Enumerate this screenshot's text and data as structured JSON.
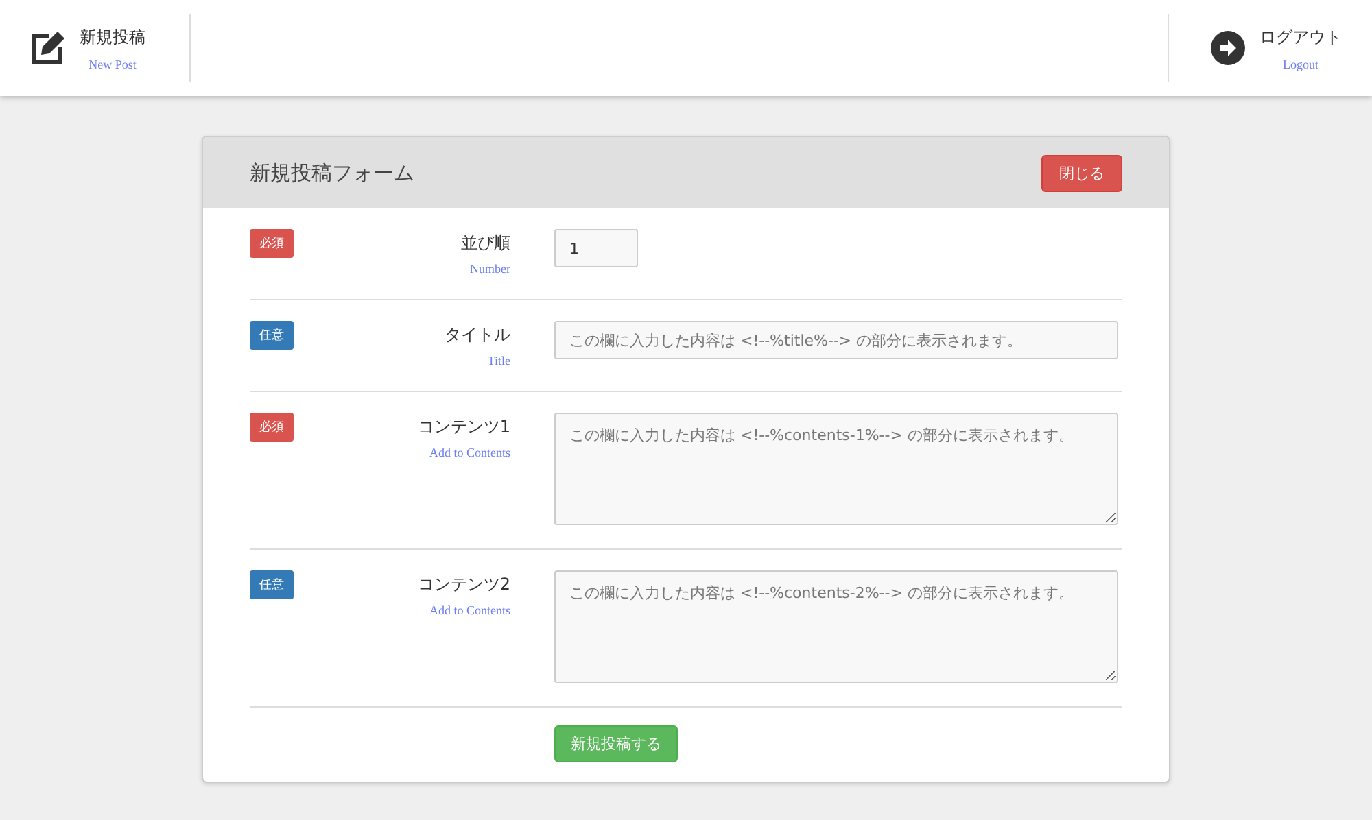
{
  "header": {
    "left": {
      "label": "新規投稿",
      "sublabel": "New Post"
    },
    "right": {
      "label": "ログアウト",
      "sublabel": "Logout"
    }
  },
  "form": {
    "title": "新規投稿フォーム",
    "close_button": "閉じる",
    "fields": [
      {
        "kind": "number",
        "badge": "必須",
        "required": true,
        "label": "並び順",
        "sublabel": "Number",
        "value": "1"
      },
      {
        "kind": "text",
        "badge": "任意",
        "required": false,
        "label": "タイトル",
        "sublabel": "Title",
        "placeholder": "この欄に入力した内容は <!--%title%--> の部分に表示されます。"
      },
      {
        "kind": "textarea",
        "badge": "必須",
        "required": true,
        "label": "コンテンツ1",
        "sublabel": "Add to Contents",
        "placeholder": "この欄に入力した内容は <!--%contents-1%--> の部分に表示されます。"
      },
      {
        "kind": "textarea",
        "badge": "任意",
        "required": false,
        "label": "コンテンツ2",
        "sublabel": "Add to Contents",
        "placeholder": "この欄に入力した内容は <!--%contents-2%--> の部分に表示されます。"
      }
    ],
    "submit_button": "新規投稿する"
  }
}
